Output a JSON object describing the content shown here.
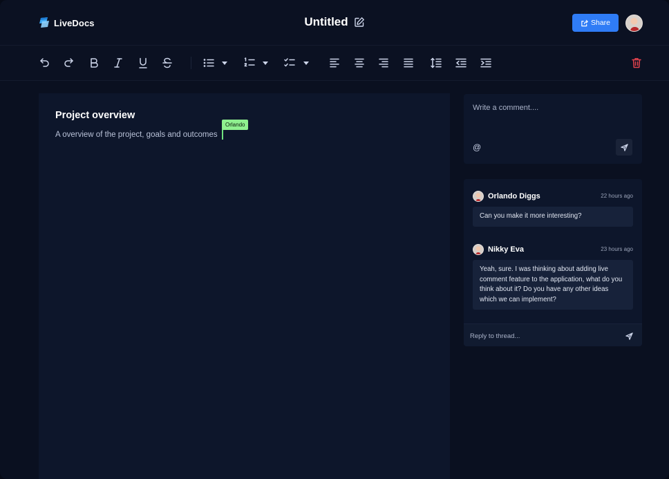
{
  "app": {
    "name": "LiveDocs",
    "logo_icon": "livedocs-logo-icon"
  },
  "header": {
    "doc_title": "Untitled",
    "edit_icon": "pencil-square-icon",
    "share_label": "Share",
    "share_icon": "share-arrow-icon"
  },
  "toolbar": {
    "icons": [
      "undo-icon",
      "redo-icon",
      "bold-icon",
      "italic-icon",
      "underline-icon",
      "strikethrough-icon",
      "bullet-list-icon",
      "numbered-list-icon",
      "checklist-icon",
      "align-left-icon",
      "align-center-icon",
      "align-right-icon",
      "align-justify-icon",
      "line-height-icon",
      "outdent-icon",
      "indent-icon",
      "trash-icon"
    ]
  },
  "editor": {
    "heading": "Project overview",
    "body": "A overview of the project, goals and outcomes",
    "collaborator_cursor": "Orlando"
  },
  "comment_input": {
    "placeholder": "Write a comment....",
    "mention_symbol": "@",
    "send_icon": "send-icon"
  },
  "thread": {
    "comments": [
      {
        "author": "Orlando Diggs",
        "time": "22 hours ago",
        "text": "Can you make it more interesting?"
      },
      {
        "author": "Nikky Eva",
        "time": "23 hours ago",
        "text": "Yeah, sure. I was thinking about adding live comment feature to the application, what do you think about it? Do you have any other ideas which we can implement?"
      }
    ],
    "reply_placeholder": "Reply to thread..."
  },
  "colors": {
    "background": "#0a1020",
    "panel": "#0d162b",
    "accent": "#2f7cf6",
    "cursor_tag": "#8ff08f",
    "danger": "#e0424d"
  }
}
